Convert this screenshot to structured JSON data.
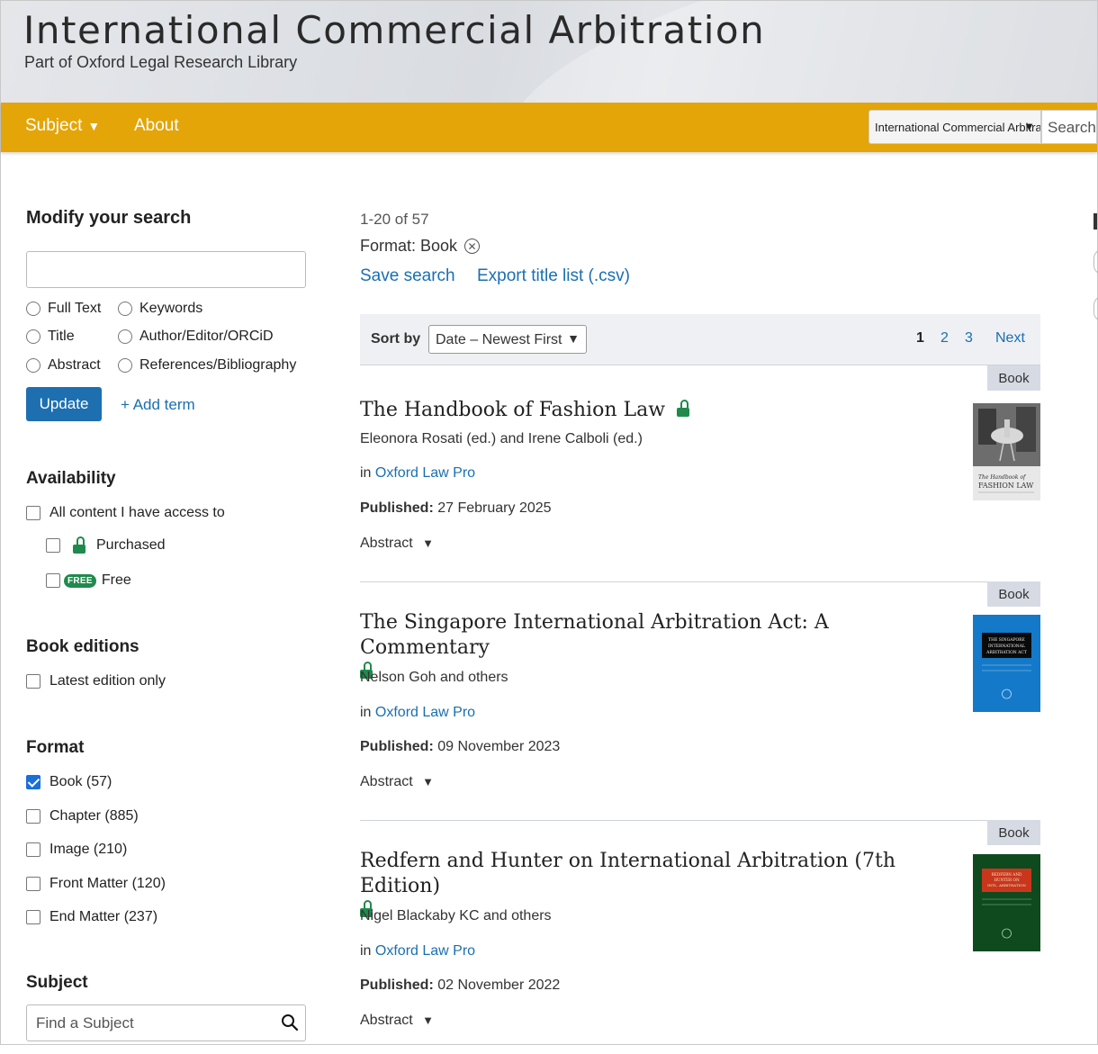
{
  "header": {
    "title": "International Commercial Arbitration",
    "subtitle": "Part of Oxford Legal Research Library"
  },
  "nav": {
    "subject_label": "Subject",
    "about_label": "About",
    "search_scope": "International Commercial Arbitration",
    "search_placeholder": "Search"
  },
  "sidebar": {
    "modify_heading": "Modify your search",
    "search_value": "",
    "radios": [
      "Full Text",
      "Keywords",
      "Title",
      "Author/Editor/ORCiD",
      "Abstract",
      "References/Bibliography"
    ],
    "update_label": "Update",
    "add_term_label": "+ Add term",
    "availability_heading": "Availability",
    "availability_all": "All content I have access to",
    "availability_purchased": "Purchased",
    "free_badge": "FREE",
    "availability_free": "Free",
    "editions_heading": "Book editions",
    "editions_latest": "Latest edition only",
    "format_heading": "Format",
    "formats": [
      {
        "label": "Book (57)",
        "checked": true
      },
      {
        "label": "Chapter (885)",
        "checked": false
      },
      {
        "label": "Image (210)",
        "checked": false
      },
      {
        "label": "Front Matter (120)",
        "checked": false
      },
      {
        "label": "End Matter (237)",
        "checked": false
      }
    ],
    "subject_heading": "Subject",
    "subject_placeholder": "Find a Subject"
  },
  "results": {
    "count": "1-20 of 57",
    "filter_label": "Format: Book",
    "save_search": "Save search",
    "export_list": "Export title list (.csv)",
    "sort_label": "Sort by",
    "sort_value": "Date – Newest First",
    "pages": [
      "1",
      "2",
      "3"
    ],
    "next_label": "Next",
    "items": [
      {
        "type": "Book",
        "title": "The Handbook of Fashion Law",
        "authors": "Eleonora Rosati (ed.) and Irene Calboli (ed.)",
        "in_prefix": "in",
        "collection": "Oxford Law Pro",
        "published_label": "Published:",
        "published_date": "27 February 2025",
        "abstract_label": "Abstract",
        "cover_title": "The Handbook of FASHION LAW",
        "cover_color": "#e8e8e8"
      },
      {
        "type": "Book",
        "title": "The Singapore International Arbitration Act: A Commentary",
        "authors": "Nelson Goh and others",
        "in_prefix": "in",
        "collection": "Oxford Law Pro",
        "published_label": "Published:",
        "published_date": "09 November 2023",
        "abstract_label": "Abstract",
        "cover_title": "THE SINGAPORE INTERNATIONAL ARBITRATION ACT",
        "cover_color": "#1479c9"
      },
      {
        "type": "Book",
        "title": "Redfern and Hunter on International Arbitration (7th Edition)",
        "authors": "Nigel Blackaby KC and others",
        "in_prefix": "in",
        "collection": "Oxford Law Pro",
        "published_label": "Published:",
        "published_date": "02 November 2022",
        "abstract_label": "Abstract",
        "cover_title": "REDFERN AND HUNTER ON INTERNATIONAL ARBITRATION",
        "cover_color": "#0f4a1e"
      }
    ]
  },
  "colors": {
    "navbar": "#e3a508",
    "link": "#1a6fb0",
    "update_button": "#1d6fb0",
    "lock_green": "#1f8a4c"
  }
}
